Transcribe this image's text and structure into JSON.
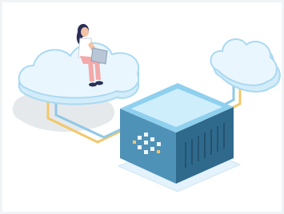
{
  "scene": {
    "subject": "cloud-computing-illustration",
    "colors": {
      "background": "#f1f4f7",
      "panel": "#ffffff",
      "cloud_fill": "#eaf6fd",
      "cloud_stroke": "#a9d9f2",
      "shadow": "#e6e9ec",
      "server_dark": "#2f6a8d",
      "server_mid": "#4f92b8",
      "server_top": "#cfeefc",
      "cable_yellow": "#f1c86a",
      "cable_blue": "#8fc9e6",
      "skin": "#f2c3a6",
      "hair": "#2b2f55",
      "shirt": "#ffffff",
      "pants": "#f3a9a9",
      "laptop": "#b9c6d6"
    },
    "icons": [
      "cloud-icon",
      "server-icon",
      "person-with-laptop-icon"
    ]
  }
}
